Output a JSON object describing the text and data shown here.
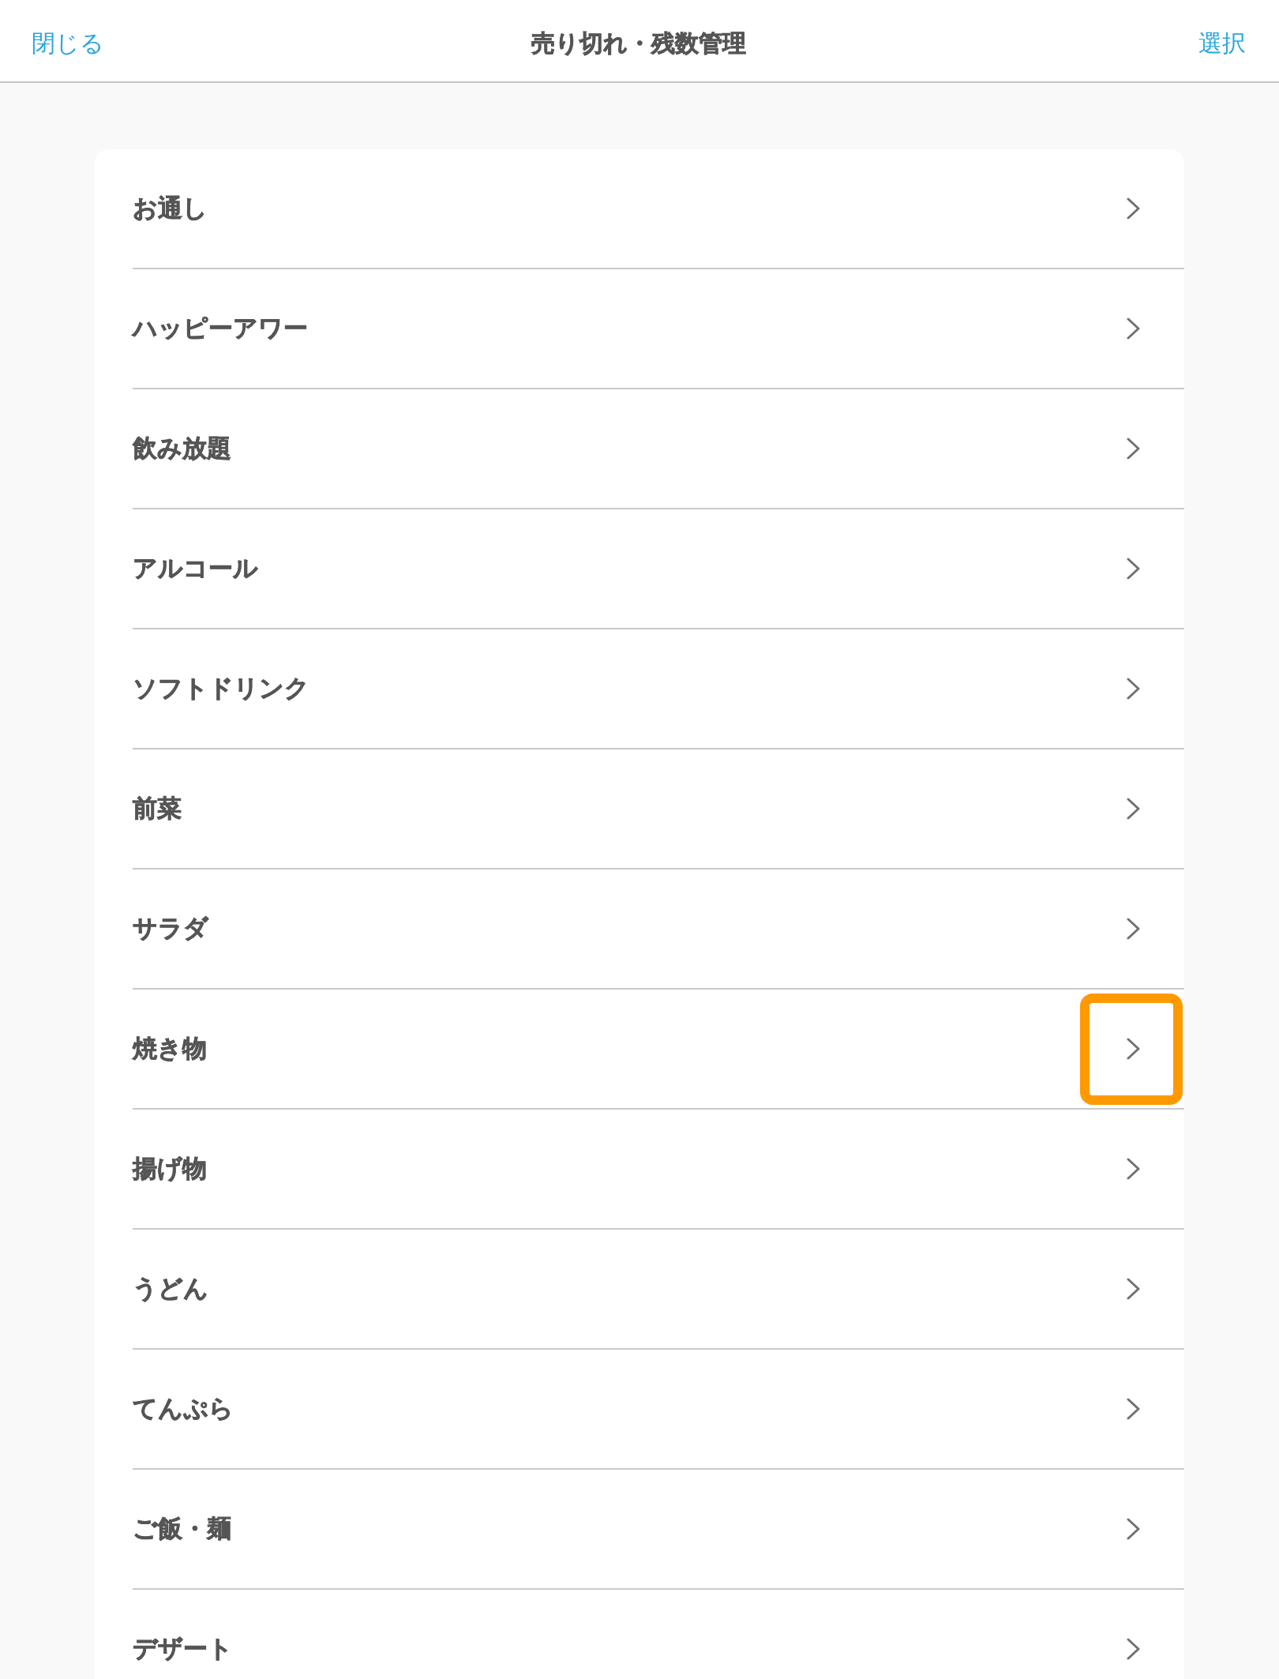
{
  "header": {
    "close_label": "閉じる",
    "title": "売り切れ・残数管理",
    "select_label": "選択"
  },
  "categories": [
    {
      "label": "お通し",
      "highlighted": false
    },
    {
      "label": "ハッピーアワー",
      "highlighted": false
    },
    {
      "label": "飲み放題",
      "highlighted": false
    },
    {
      "label": "アルコール",
      "highlighted": false
    },
    {
      "label": "ソフトドリンク",
      "highlighted": false
    },
    {
      "label": "前菜",
      "highlighted": false
    },
    {
      "label": "サラダ",
      "highlighted": false
    },
    {
      "label": "焼き物",
      "highlighted": true
    },
    {
      "label": "揚げ物",
      "highlighted": false
    },
    {
      "label": "うどん",
      "highlighted": false
    },
    {
      "label": "てんぷら",
      "highlighted": false
    },
    {
      "label": "ご飯・麺",
      "highlighted": false
    },
    {
      "label": "デザート",
      "highlighted": false
    }
  ]
}
